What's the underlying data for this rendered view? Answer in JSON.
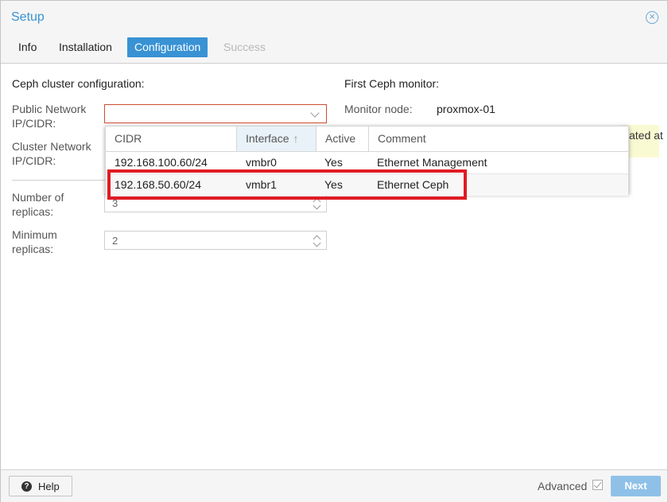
{
  "window": {
    "title": "Setup",
    "close_icon": "close-icon"
  },
  "tabs": [
    {
      "label": "Info"
    },
    {
      "label": "Installation"
    },
    {
      "label": "Configuration",
      "active": true
    },
    {
      "label": "Success",
      "disabled": true
    }
  ],
  "ceph_config": {
    "heading": "Ceph cluster configuration:",
    "public_network_label_1": "Public Network",
    "public_network_label_2": "IP/CIDR:",
    "public_network_value": "",
    "cluster_network_label_1": "Cluster Network",
    "cluster_network_label_2": "IP/CIDR:",
    "replicas_label_1": "Number of",
    "replicas_label_2": "replicas:",
    "replicas_value": "3",
    "min_replicas_label_1": "Minimum",
    "min_replicas_label_2": "replicas:",
    "min_replicas_value": "2"
  },
  "monitor": {
    "heading": "First Ceph monitor:",
    "node_label": "Monitor node:",
    "node_value": "proxmox-01",
    "hint_fragment": "ated at"
  },
  "network_grid": {
    "columns": [
      {
        "label": "CIDR"
      },
      {
        "label": "Interface",
        "sorted": "ascending"
      },
      {
        "label": "Active"
      },
      {
        "label": "Comment"
      }
    ],
    "rows": [
      {
        "cidr": "192.168.100.60/24",
        "interface": "vmbr0",
        "active": "Yes",
        "comment": "Ethernet Management"
      },
      {
        "cidr": "192.168.50.60/24",
        "interface": "vmbr1",
        "active": "Yes",
        "comment": "Ethernet Ceph",
        "highlighted": true
      }
    ]
  },
  "footer": {
    "help_label": "Help",
    "help_icon": "question-circle-icon",
    "advanced_label": "Advanced",
    "advanced_checked": true,
    "next_label": "Next"
  },
  "colors": {
    "accent": "#3892d4",
    "highlight_border": "#e01b24",
    "next_disabled": "#8fc1e8",
    "invalid_border": "#cf4c35"
  }
}
